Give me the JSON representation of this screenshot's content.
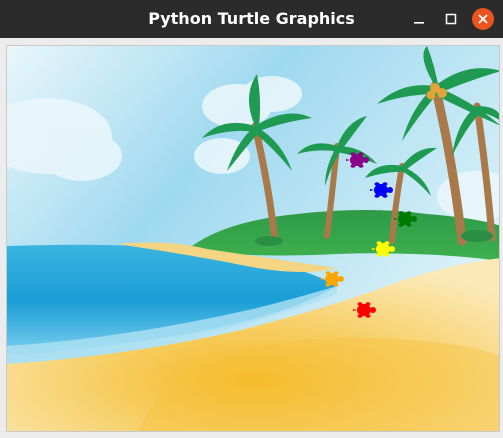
{
  "window": {
    "title": "Python Turtle Graphics",
    "controls": {
      "minimize": "minimize",
      "maximize": "maximize",
      "close": "close"
    }
  },
  "colors": {
    "titlebar": "#2b2b2b",
    "close_button": "#e95420",
    "sky": "#bfe6f5",
    "sea": "#1aa4d8",
    "sand": "#f6cf6a",
    "island": "#3aa84a",
    "palm_leaf": "#1f9a52",
    "palm_trunk": "#a9794a"
  },
  "turtles": [
    {
      "name": "purple-turtle",
      "color": "#8b008b",
      "heading": "east"
    },
    {
      "name": "blue-turtle",
      "color": "#0000ff",
      "heading": "east"
    },
    {
      "name": "green-turtle",
      "color": "#007a00",
      "heading": "east"
    },
    {
      "name": "yellow-turtle",
      "color": "#ffff00",
      "heading": "east"
    },
    {
      "name": "orange-turtle",
      "color": "#ffa500",
      "heading": "east"
    },
    {
      "name": "red-turtle",
      "color": "#ff0000",
      "heading": "east"
    }
  ]
}
